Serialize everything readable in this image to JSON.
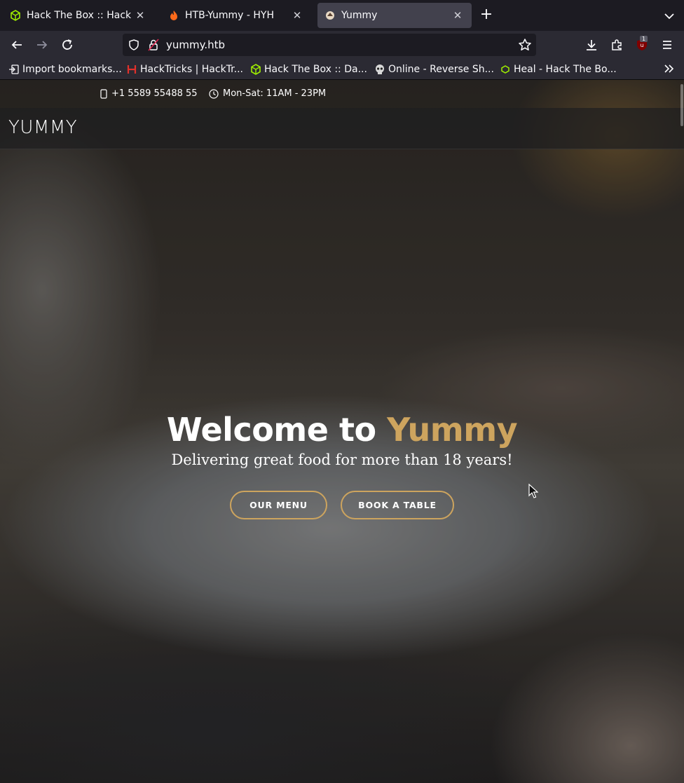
{
  "browser": {
    "tabs": [
      {
        "title": "Hack The Box :: Hack Th",
        "icon": "htb-cube-icon",
        "active": false
      },
      {
        "title": "HTB-Yummy - HYH",
        "icon": "flame-icon",
        "active": false
      },
      {
        "title": "Yummy",
        "icon": "site-favicon-icon",
        "active": true
      }
    ],
    "url": "yummy.htb",
    "extension_badge": "1",
    "bookmarks": [
      {
        "label": "Import bookmarks...",
        "icon": "import-icon"
      },
      {
        "label": "HackTricks | HackTr...",
        "icon": "hacktricks-icon"
      },
      {
        "label": "Hack The Box :: Da...",
        "icon": "htb-cube-icon"
      },
      {
        "label": "Online - Reverse Sh...",
        "icon": "skull-icon"
      },
      {
        "label": "Heal - Hack The Bo...",
        "icon": "htb-small-icon"
      }
    ]
  },
  "site": {
    "topbar": {
      "phone": "+1 5589 55488 55",
      "hours": "Mon-Sat: 11AM - 23PM"
    },
    "logo": "YUMMY",
    "hero": {
      "title_prefix": "Welcome to ",
      "title_accent": "Yummy",
      "subtitle": "Delivering great food for more than 18 years!",
      "menu_button": "OUR MENU",
      "book_button": "BOOK A TABLE"
    }
  },
  "colors": {
    "accent": "#cda45e",
    "chrome_dark": "#1c1b22",
    "chrome": "#2b2a33",
    "active_tab": "#42414d"
  }
}
